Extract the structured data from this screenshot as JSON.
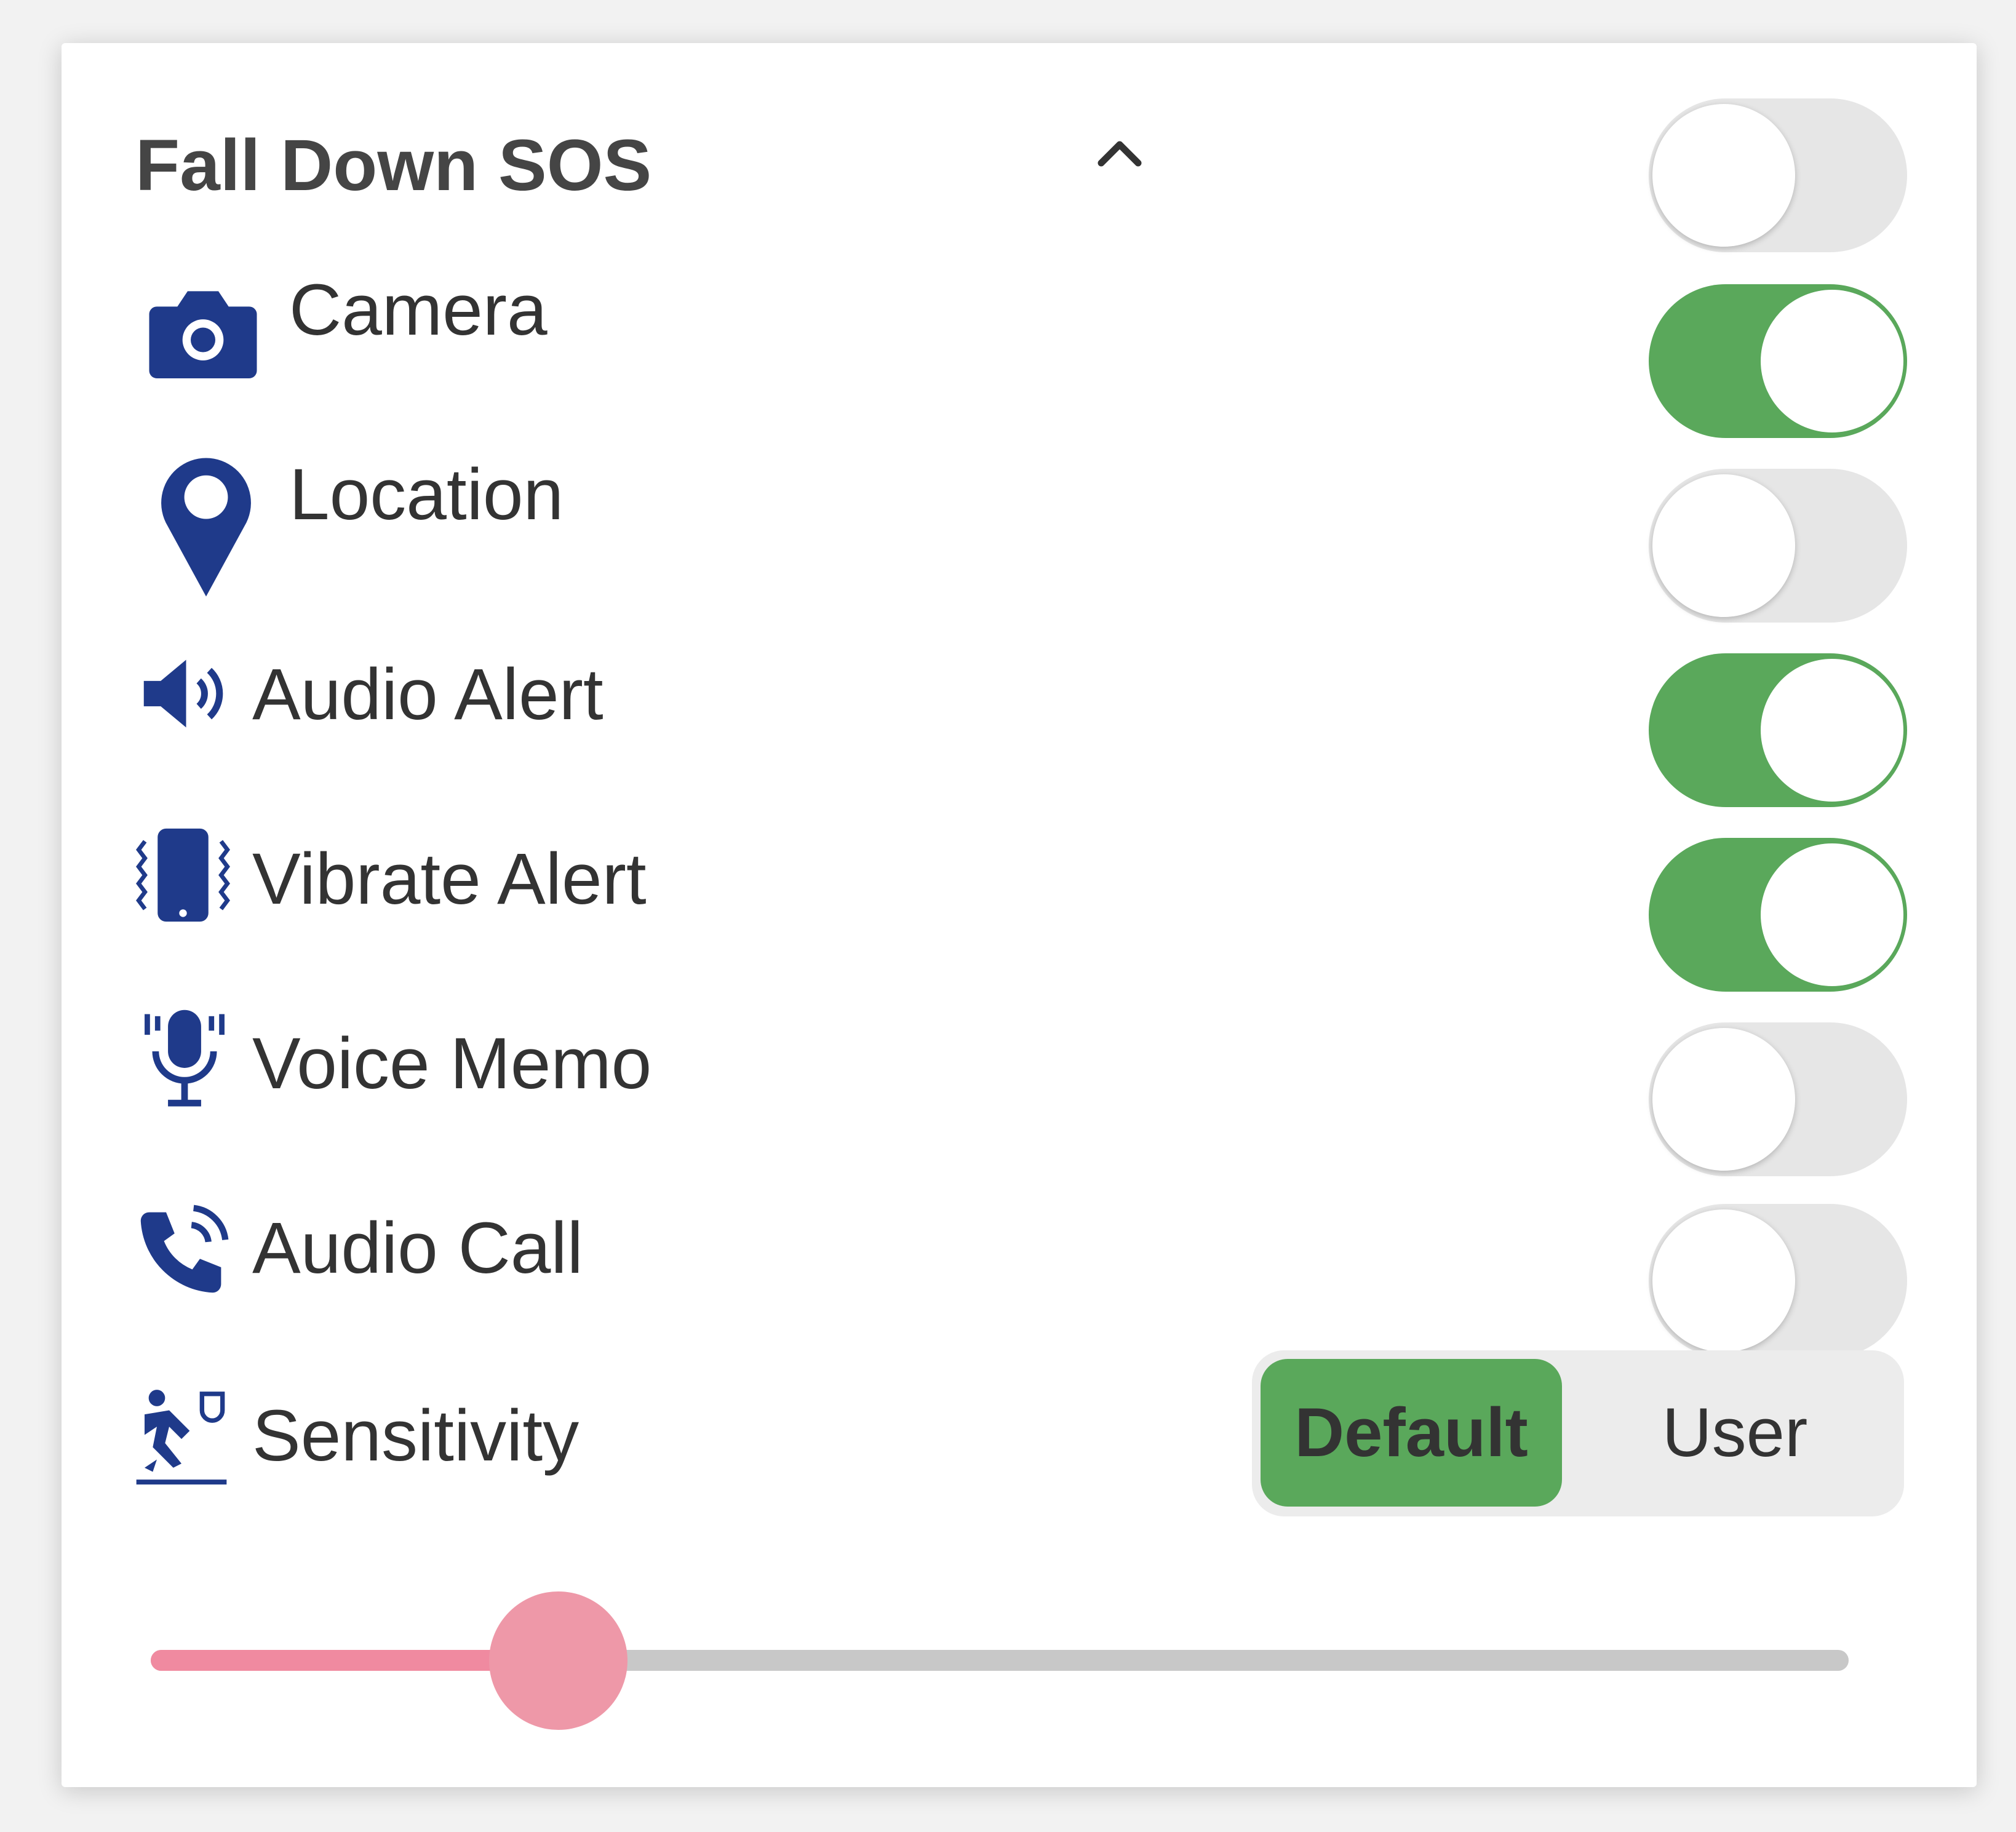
{
  "header": {
    "title": "Fall Down SOS",
    "master_toggle_on": false
  },
  "colors": {
    "on": "#5aa85b",
    "off": "#e6e6e6",
    "icon": "#1f3a8a",
    "slider": "#f08aa0"
  },
  "rows": [
    {
      "label": "Camera",
      "icon": "camera-icon",
      "on": true
    },
    {
      "label": "Location",
      "icon": "location-pin-icon",
      "on": false
    },
    {
      "label": "Audio Alert",
      "icon": "speaker-icon",
      "on": true
    },
    {
      "label": "Vibrate Alert",
      "icon": "vibrate-phone-icon",
      "on": true
    },
    {
      "label": "Voice Memo",
      "icon": "microphone-icon",
      "on": false
    },
    {
      "label": "Audio Call",
      "icon": "phone-call-icon",
      "on": false
    }
  ],
  "sensitivity": {
    "label": "Sensitivity",
    "icon": "fall-person-icon",
    "options": [
      "Default",
      "User"
    ],
    "selected": "Default",
    "slider_value": 0.24
  }
}
